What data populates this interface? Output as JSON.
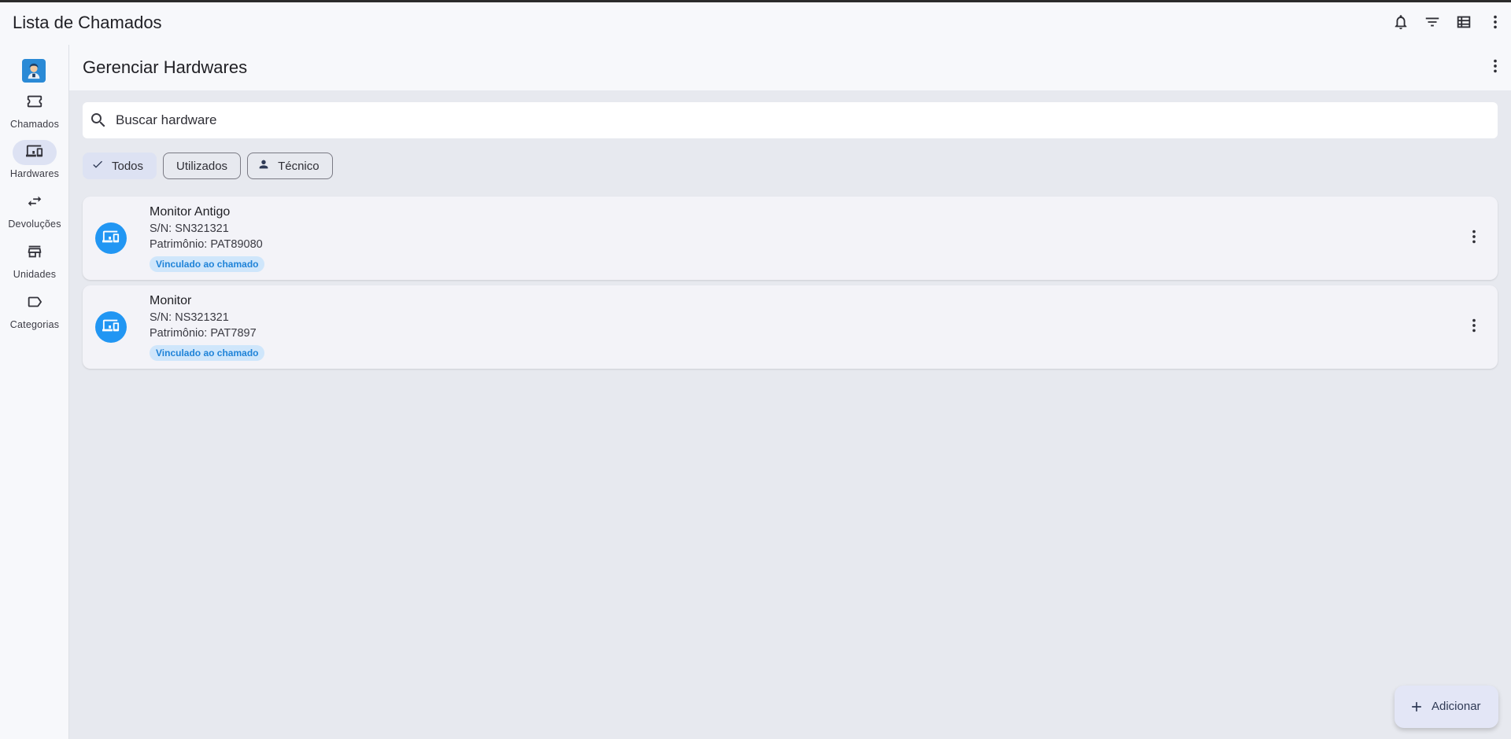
{
  "app": {
    "title": "Lista de Chamados",
    "actions": [
      {
        "icon": "bell-icon"
      },
      {
        "icon": "filter-icon"
      },
      {
        "icon": "table-view-icon"
      },
      {
        "icon": "more-vert-icon"
      }
    ]
  },
  "sidebar": {
    "logo": "technician-logo",
    "items": [
      {
        "label": "Chamados",
        "icon": "ticket-icon",
        "active": false
      },
      {
        "label": "Hardwares",
        "icon": "devices-icon",
        "active": true
      },
      {
        "label": "Devoluções",
        "icon": "swap-arrows-icon",
        "active": false
      },
      {
        "label": "Unidades",
        "icon": "store-icon",
        "active": false
      },
      {
        "label": "Categorias",
        "icon": "label-icon",
        "active": false
      }
    ]
  },
  "main": {
    "title": "Gerenciar Hardwares",
    "search": {
      "placeholder": "Buscar hardware",
      "value": ""
    },
    "filters": [
      {
        "label": "Todos",
        "selected": true,
        "icon": "check-icon"
      },
      {
        "label": "Utilizados",
        "selected": false
      },
      {
        "label": "Técnico",
        "selected": false,
        "icon": "person-icon"
      }
    ],
    "hardwares": [
      {
        "name": "Monitor Antigo",
        "serial": "S/N: SN321321",
        "asset": "Patrimônio: PAT89080",
        "badge": "Vinculado ao chamado"
      },
      {
        "name": "Monitor",
        "serial": "S/N: NS321321",
        "asset": "Patrimônio: PAT7897",
        "badge": "Vinculado ao chamado"
      }
    ],
    "fab_label": "Adicionar"
  },
  "colors": {
    "accent": "#2196f3",
    "badge_bg": "#cfe6fb",
    "badge_text": "#1f83d8",
    "selected_bg": "#dde2f3"
  }
}
